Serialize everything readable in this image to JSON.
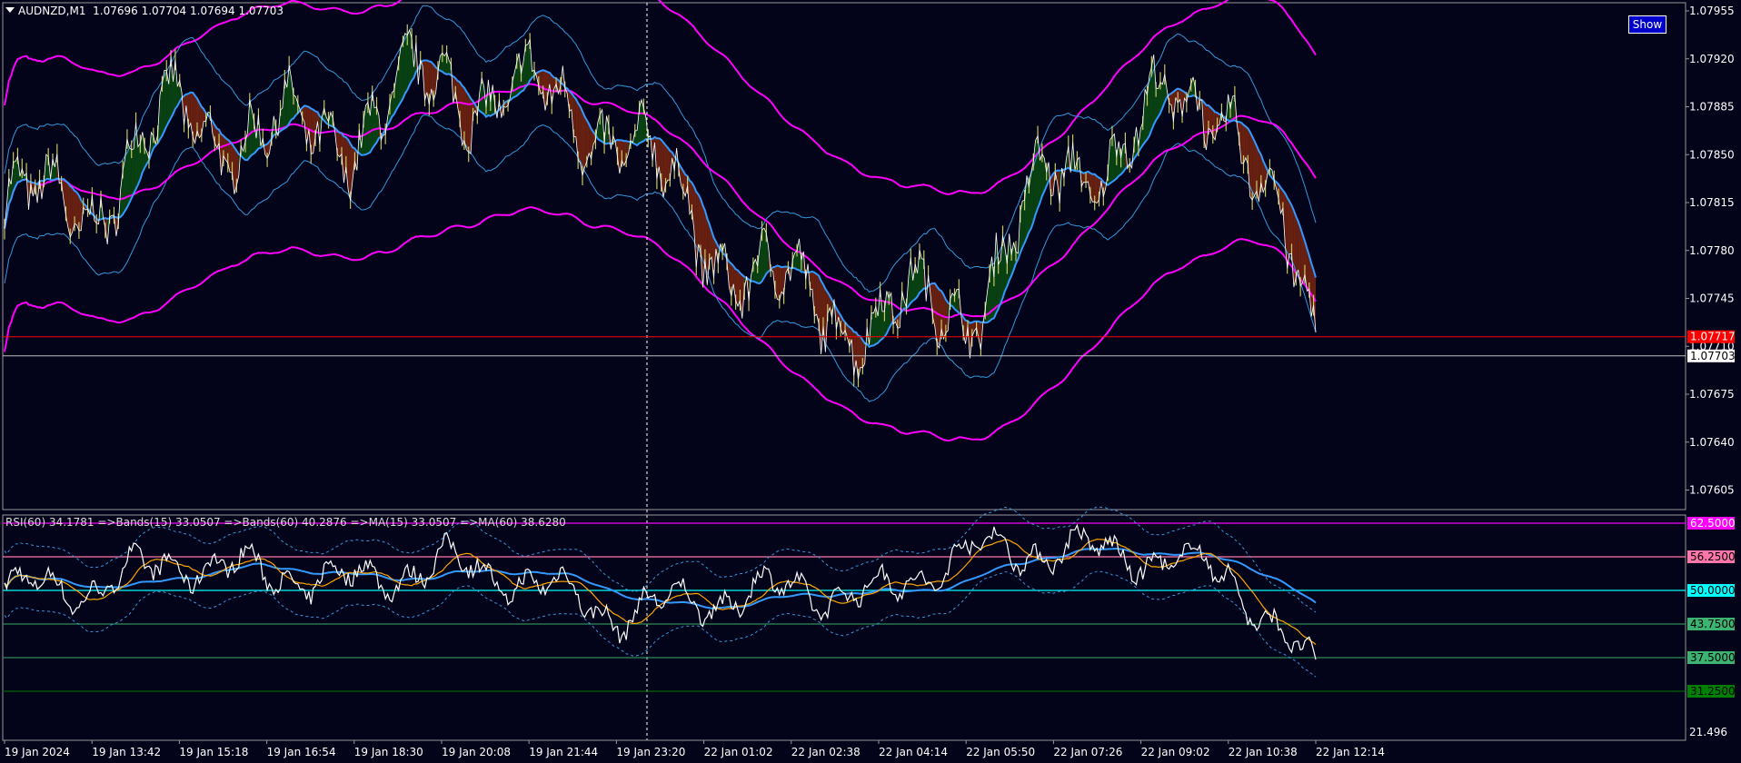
{
  "header": {
    "menu_icon": "triangle-down-icon",
    "symbol_period": "AUDNZD,M1",
    "ohlc": "1.07696 1.07704 1.07694 1.07703"
  },
  "show_button_label": "Show",
  "main_axis": {
    "ticks": [
      "1.07955",
      "1.07920",
      "1.07885",
      "1.07850",
      "1.07815",
      "1.07780",
      "1.07745",
      "1.07710",
      "1.07675",
      "1.07640",
      "1.07605"
    ],
    "red_line": {
      "label": "1.07717",
      "color": "#ff0000"
    },
    "price_line": {
      "label": "1.07703",
      "color": "#c0c0c0"
    }
  },
  "sub_window": {
    "title": "RSI(60) 34.1781  =>Bands(15) 33.0507  =>Bands(60) 40.2876  =>MA(15) 33.0507  =>MA(60) 38.6280",
    "bottom_tick": "21.496",
    "levels": [
      {
        "label": "62.5000",
        "color": "#ff00ff",
        "box_color": "#ff00ff",
        "text_color": "#ffffff"
      },
      {
        "label": "56.2500",
        "color": "#ff77aa",
        "box_color": "#ff77aa",
        "text_color": "#000000"
      },
      {
        "label": "50.0000",
        "color": "#00ffff",
        "box_color": "#00ffff",
        "text_color": "#000000"
      },
      {
        "label": "43.7500",
        "color": "#2e8b57",
        "box_color": "#3cb371",
        "text_color": "#000000"
      },
      {
        "label": "37.5000",
        "color": "#2e8b57",
        "box_color": "#3cb371",
        "text_color": "#000000"
      },
      {
        "label": "31.2500",
        "color": "#006400",
        "box_color": "#008000",
        "text_color": "#000000"
      }
    ]
  },
  "time_axis": [
    "19 Jan 2024",
    "19 Jan 13:42",
    "19 Jan 15:18",
    "19 Jan 16:54",
    "19 Jan 18:30",
    "19 Jan 20:08",
    "19 Jan 21:44",
    "19 Jan 23:20",
    "22 Jan 01:02",
    "22 Jan 02:38",
    "22 Jan 04:14",
    "22 Jan 05:50",
    "22 Jan 07:26",
    "22 Jan 09:02",
    "22 Jan 10:38",
    "22 Jan 12:14"
  ],
  "colors": {
    "background": "#03031a",
    "envelope": "#ff00ff",
    "bands": "#3399dd",
    "ma": "#3399ff",
    "candles": "#c8c864",
    "fill_up": "#0a4d12",
    "fill_down": "#7a2610",
    "rsi": "#ffffff",
    "rsi_ma": "#ffa500"
  },
  "chart_data": {
    "type": "line",
    "symbol": "AUDNZD",
    "timeframe": "M1",
    "ylim": [
      1.07585,
      1.07965
    ],
    "x": [
      "19 Jan 2024",
      "19 Jan 13:42",
      "19 Jan 15:18",
      "19 Jan 16:54",
      "19 Jan 18:30",
      "19 Jan 20:08",
      "19 Jan 21:44",
      "19 Jan 23:20",
      "22 Jan 01:02",
      "22 Jan 02:38",
      "22 Jan 04:14",
      "22 Jan 05:50",
      "22 Jan 07:26",
      "22 Jan 09:02",
      "22 Jan 10:38",
      "22 Jan 12:14"
    ],
    "series": [
      {
        "name": "AUDNZD,M1",
        "values": [
          1.0781,
          1.07815,
          1.0788,
          1.0786,
          1.0787,
          1.07905,
          1.0789,
          1.0787,
          1.0779,
          1.07745,
          1.0773,
          1.0774,
          1.0783,
          1.0787,
          1.07895,
          1.0771
        ]
      },
      {
        "name": "RSI(60)",
        "values": [
          50.1,
          50.6,
          55.5,
          53.1,
          51.5,
          55.1,
          51.7,
          45.6,
          48.4,
          50.2,
          48.9,
          57.2,
          57.7,
          56.5,
          53.1,
          34.2
        ]
      }
    ],
    "levels": [
      62.5,
      56.25,
      50.0,
      43.75,
      37.5,
      31.25
    ],
    "horizontal_lines": [
      1.07717,
      1.07703
    ]
  }
}
